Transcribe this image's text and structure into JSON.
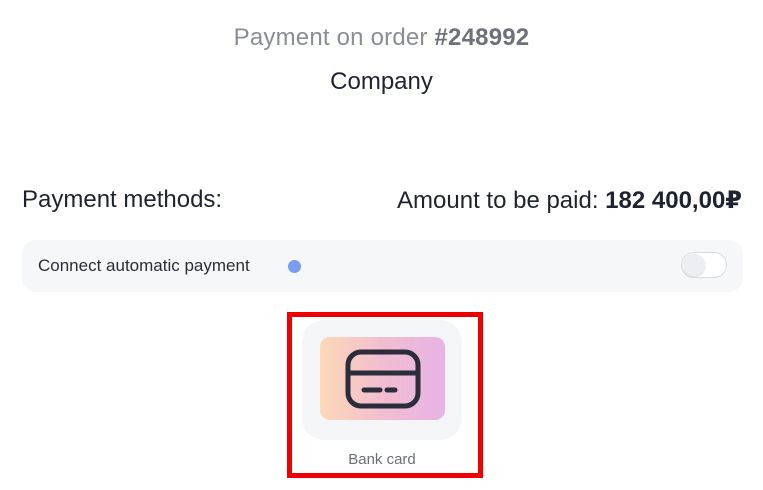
{
  "header": {
    "order_prefix": "Payment on order",
    "order_number": "#248992",
    "company": "Company"
  },
  "payment": {
    "methods_label": "Payment methods:",
    "amount_label": "Amount to be paid:",
    "amount_value": "182 400,00₽"
  },
  "auto_payment": {
    "label": "Connect automatic payment",
    "enabled": false,
    "info_dot_color": "#7a9bef"
  },
  "methods": [
    {
      "label": "Bank card",
      "icon": "credit-card-icon",
      "selected": true
    }
  ],
  "colors": {
    "highlight": "#ee0000",
    "tile_gradient_start": "#fcd9b7",
    "tile_gradient_end": "#e6b3e5"
  }
}
